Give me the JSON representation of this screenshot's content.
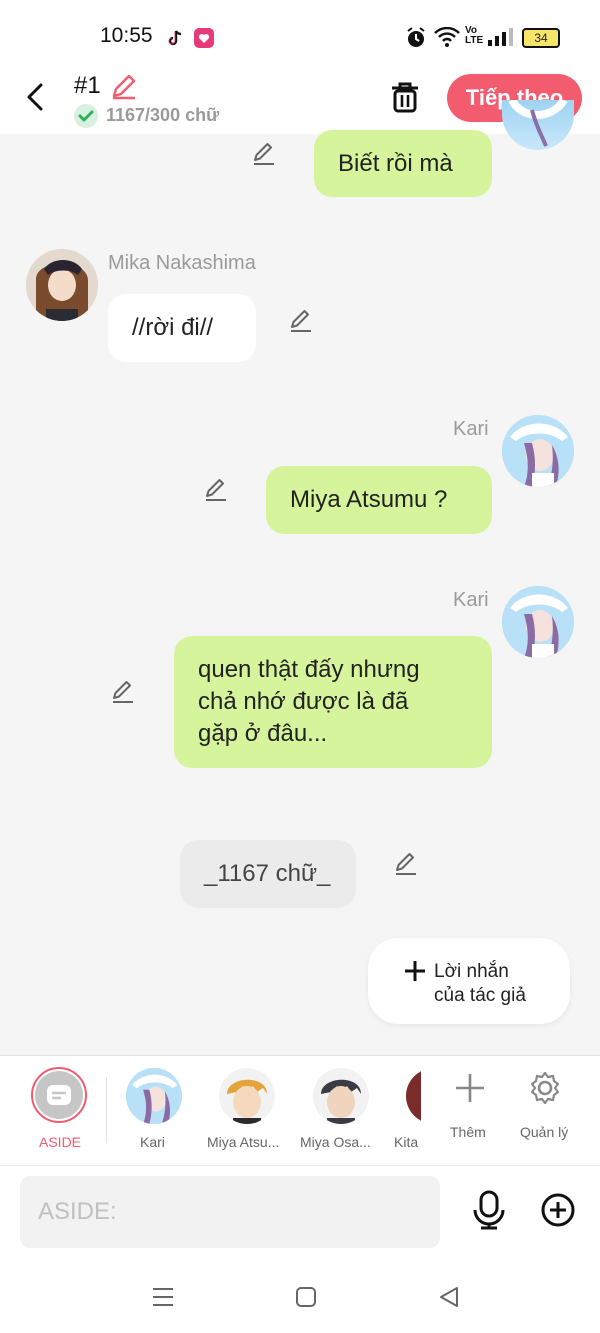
{
  "status_bar": {
    "time": "10:55",
    "battery": "34",
    "network": "Vo LTE"
  },
  "header": {
    "title": "#1",
    "word_count": "1167/300 chữ",
    "next_button": "Tiếp theo"
  },
  "chat": {
    "msg_top": {
      "text": "Biết rồi mà"
    },
    "msg_mika": {
      "sender": "Mika Nakashima",
      "text": "//rời đi//"
    },
    "msg_kari_1": {
      "sender": "Kari",
      "text": "Miya Atsumu ?"
    },
    "msg_kari_2": {
      "sender": "Kari",
      "line1": "quen thật đấy nhưng",
      "line2": "chả nhớ được là đã",
      "line3": "gặp ở đâu..."
    },
    "msg_aside": {
      "text": "_1167 chữ_"
    }
  },
  "author_note": {
    "line1": "Lời nhắn",
    "line2": "của tác giả"
  },
  "characters": [
    {
      "label": "ASIDE"
    },
    {
      "label": "Kari"
    },
    {
      "label": "Miya Atsu..."
    },
    {
      "label": "Miya Osa..."
    },
    {
      "label": "Kita"
    }
  ],
  "actions": {
    "add": "Thêm",
    "manage": "Quản lý"
  },
  "input": {
    "placeholder": "ASIDE:"
  },
  "colors": {
    "accent": "#f35b6f",
    "bubble_green": "#d6f49c"
  }
}
